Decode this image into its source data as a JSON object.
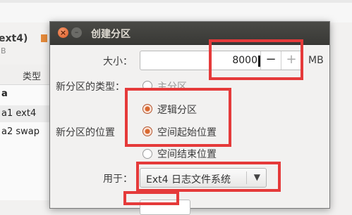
{
  "background": {
    "partition_title": "ext4)",
    "size_unit_text": "iB",
    "column_type": "类型",
    "rows": [
      {
        "name": "a1",
        "type": "ext4"
      },
      {
        "name": "a2",
        "type": "swap"
      }
    ]
  },
  "dialog": {
    "title": "创建分区",
    "size_label": "大小：",
    "size_value": "8000",
    "size_unit": "MB",
    "type_label": "新分区的类型：",
    "type_options": [
      "主分区",
      "逻辑分区"
    ],
    "type_selected": "逻辑分区",
    "location_label": "新分区的位置",
    "location_options": [
      "空间起始位置",
      "空间结束位置"
    ],
    "location_selected": "空间起始位置",
    "use_as_label": "用于：",
    "use_as_value": "Ext4 日志文件系统"
  },
  "colors": {
    "highlight": "#e53a3a",
    "titlebar": "#3f3f3c",
    "radio_active": "#d9682f"
  }
}
